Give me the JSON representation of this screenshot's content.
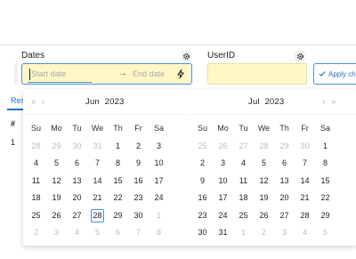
{
  "form": {
    "dates_label": "Dates",
    "date_start_placeholder": "Start date",
    "date_end_placeholder": "End date",
    "userid_label": "UserID",
    "apply_label": "Apply ch"
  },
  "results": {
    "tab_label": "Res",
    "hash_header": "#",
    "row_number": "1",
    "right_text": "\">"
  },
  "calendar": {
    "weekdays": [
      "Su",
      "Mo",
      "Tu",
      "We",
      "Th",
      "Fr",
      "Sa"
    ],
    "left": {
      "month": "Jun",
      "year": "2023",
      "days": [
        {
          "d": "28",
          "out": true
        },
        {
          "d": "29",
          "out": true
        },
        {
          "d": "30",
          "out": true
        },
        {
          "d": "31",
          "out": true
        },
        {
          "d": "1"
        },
        {
          "d": "2"
        },
        {
          "d": "3"
        },
        {
          "d": "4"
        },
        {
          "d": "5"
        },
        {
          "d": "6"
        },
        {
          "d": "7"
        },
        {
          "d": "8"
        },
        {
          "d": "9"
        },
        {
          "d": "10"
        },
        {
          "d": "11"
        },
        {
          "d": "12"
        },
        {
          "d": "13"
        },
        {
          "d": "14"
        },
        {
          "d": "15"
        },
        {
          "d": "16"
        },
        {
          "d": "17"
        },
        {
          "d": "18"
        },
        {
          "d": "19"
        },
        {
          "d": "20"
        },
        {
          "d": "21"
        },
        {
          "d": "22"
        },
        {
          "d": "23"
        },
        {
          "d": "24"
        },
        {
          "d": "25"
        },
        {
          "d": "26"
        },
        {
          "d": "27"
        },
        {
          "d": "28",
          "today": true
        },
        {
          "d": "29"
        },
        {
          "d": "30"
        },
        {
          "d": "1",
          "out": true
        },
        {
          "d": "2",
          "out": true
        },
        {
          "d": "3",
          "out": true
        },
        {
          "d": "4",
          "out": true
        },
        {
          "d": "5",
          "out": true
        },
        {
          "d": "6",
          "out": true
        },
        {
          "d": "7",
          "out": true
        },
        {
          "d": "8",
          "out": true
        }
      ]
    },
    "right": {
      "month": "Jul",
      "year": "2023",
      "days": [
        {
          "d": "25",
          "out": true
        },
        {
          "d": "26",
          "out": true
        },
        {
          "d": "27",
          "out": true
        },
        {
          "d": "28",
          "out": true
        },
        {
          "d": "29",
          "out": true
        },
        {
          "d": "30",
          "out": true
        },
        {
          "d": "1"
        },
        {
          "d": "2"
        },
        {
          "d": "3"
        },
        {
          "d": "4"
        },
        {
          "d": "5"
        },
        {
          "d": "6"
        },
        {
          "d": "7"
        },
        {
          "d": "8"
        },
        {
          "d": "9"
        },
        {
          "d": "10"
        },
        {
          "d": "11"
        },
        {
          "d": "12"
        },
        {
          "d": "13"
        },
        {
          "d": "14"
        },
        {
          "d": "15"
        },
        {
          "d": "16"
        },
        {
          "d": "17"
        },
        {
          "d": "18"
        },
        {
          "d": "19"
        },
        {
          "d": "20"
        },
        {
          "d": "21"
        },
        {
          "d": "22"
        },
        {
          "d": "23"
        },
        {
          "d": "24"
        },
        {
          "d": "25"
        },
        {
          "d": "26"
        },
        {
          "d": "27"
        },
        {
          "d": "28"
        },
        {
          "d": "29"
        },
        {
          "d": "30"
        },
        {
          "d": "31"
        },
        {
          "d": "1",
          "out": true
        },
        {
          "d": "2",
          "out": true
        },
        {
          "d": "3",
          "out": true
        },
        {
          "d": "4",
          "out": true
        },
        {
          "d": "5",
          "out": true
        }
      ]
    }
  }
}
